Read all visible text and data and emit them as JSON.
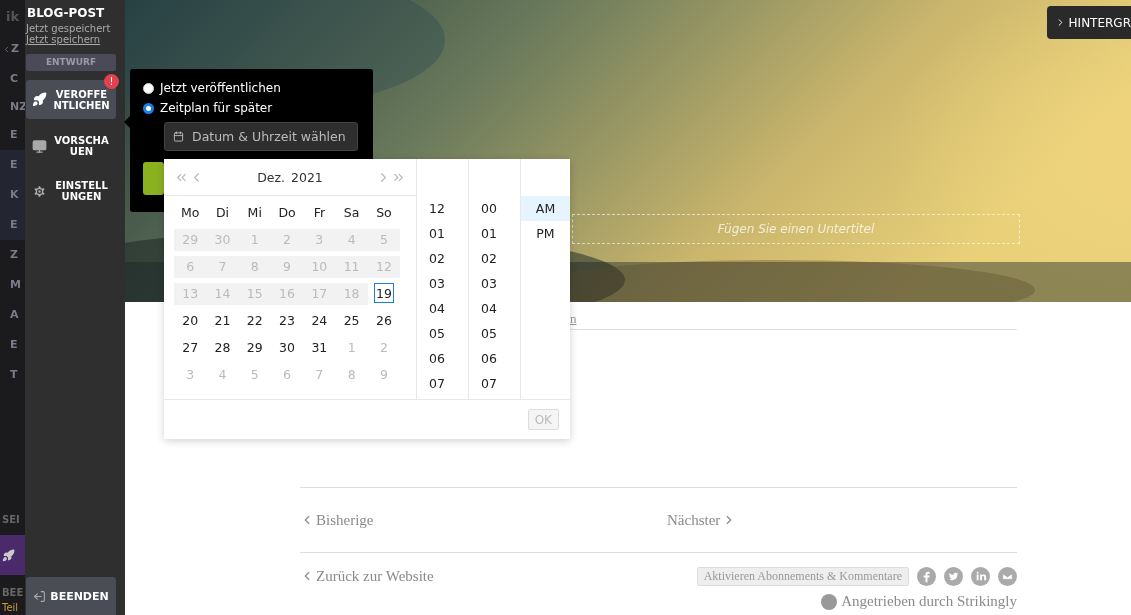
{
  "back_strip": {
    "logo": "ik",
    "items": [
      {
        "label": "Z",
        "kind": "back"
      },
      {
        "label": "C",
        "kind": "item"
      },
      {
        "label": "NZ",
        "kind": "plain"
      },
      {
        "label": "E",
        "kind": "item"
      },
      {
        "label": "E",
        "kind": "highlight"
      },
      {
        "label": "K",
        "kind": "highlight"
      },
      {
        "label": "E",
        "kind": "highlight"
      },
      {
        "label": "Z",
        "kind": "item"
      },
      {
        "label": "M",
        "kind": "item"
      },
      {
        "label": "A",
        "kind": "item"
      },
      {
        "label": "E",
        "kind": "item"
      },
      {
        "label": "T",
        "kind": "item"
      }
    ],
    "section": "SEI",
    "footer_label": "BEE",
    "footer_link": "Teil"
  },
  "sidebar": {
    "title": "BLOG-POST",
    "status": "Jetzt gespeichert",
    "save_link": "Jetzt speichern",
    "badge": "ENTWURF",
    "items": [
      {
        "label": "VEROFFE\nNTLICHEN",
        "kind": "publish",
        "selected": true,
        "alert": "!"
      },
      {
        "label": "VORSCHA\nUEN",
        "kind": "preview",
        "selected": false
      },
      {
        "label": "EINSTELL\nUNGEN",
        "kind": "settings",
        "selected": false
      }
    ],
    "exit_button": "BEENDEN"
  },
  "hero": {
    "kind": "picture",
    "background_button": "HINTERGR",
    "subtitle_placeholder": "Fügen Sie einen Untertitel"
  },
  "publish_popover": {
    "options": [
      {
        "label": "Jetzt veröffentlichen",
        "selected": false
      },
      {
        "label": "Zeitplan für später",
        "selected": true
      }
    ],
    "date_field": {
      "placeholder": "Datum & Uhrzeit wählen"
    }
  },
  "date_picker": {
    "month": "Dez.",
    "year": "2021",
    "weekdays": [
      "Mo",
      "Di",
      "Mi",
      "Do",
      "Fr",
      "Sa",
      "So"
    ],
    "weeks": [
      [
        {
          "day": "29",
          "disabled": true,
          "selected": false
        },
        {
          "day": "30",
          "disabled": true,
          "selected": false
        },
        {
          "day": "1",
          "disabled": true,
          "selected": false
        },
        {
          "day": "2",
          "disabled": true,
          "selected": false
        },
        {
          "day": "3",
          "disabled": true,
          "selected": false
        },
        {
          "day": "4",
          "disabled": true,
          "selected": false
        },
        {
          "day": "5",
          "disabled": true,
          "selected": false
        }
      ],
      [
        {
          "day": "6",
          "disabled": true,
          "selected": false
        },
        {
          "day": "7",
          "disabled": true,
          "selected": false
        },
        {
          "day": "8",
          "disabled": true,
          "selected": false
        },
        {
          "day": "9",
          "disabled": true,
          "selected": false
        },
        {
          "day": "10",
          "disabled": true,
          "selected": false
        },
        {
          "day": "11",
          "disabled": true,
          "selected": false
        },
        {
          "day": "12",
          "disabled": true,
          "selected": false
        }
      ],
      [
        {
          "day": "13",
          "disabled": true,
          "selected": false
        },
        {
          "day": "14",
          "disabled": true,
          "selected": false
        },
        {
          "day": "15",
          "disabled": true,
          "selected": false
        },
        {
          "day": "16",
          "disabled": true,
          "selected": false
        },
        {
          "day": "17",
          "disabled": true,
          "selected": false
        },
        {
          "day": "18",
          "disabled": true,
          "selected": false
        },
        {
          "day": "19",
          "disabled": false,
          "outside": false,
          "selected": true
        }
      ],
      [
        {
          "day": "20",
          "disabled": false,
          "outside": false,
          "selected": false
        },
        {
          "day": "21",
          "disabled": false,
          "outside": false,
          "selected": false
        },
        {
          "day": "22",
          "disabled": false,
          "outside": false,
          "selected": false
        },
        {
          "day": "23",
          "disabled": false,
          "outside": false,
          "selected": false
        },
        {
          "day": "24",
          "disabled": false,
          "outside": false,
          "selected": false
        },
        {
          "day": "25",
          "disabled": false,
          "outside": false,
          "selected": false
        },
        {
          "day": "26",
          "disabled": false,
          "outside": false,
          "selected": false
        }
      ],
      [
        {
          "day": "27",
          "disabled": false,
          "outside": false,
          "selected": false
        },
        {
          "day": "28",
          "disabled": false,
          "outside": false,
          "selected": false
        },
        {
          "day": "29",
          "disabled": false,
          "outside": false,
          "selected": false
        },
        {
          "day": "30",
          "disabled": false,
          "outside": false,
          "selected": false
        },
        {
          "day": "31",
          "disabled": false,
          "outside": false,
          "selected": false
        },
        {
          "day": "1",
          "disabled": false,
          "outside": true,
          "selected": false
        },
        {
          "day": "2",
          "disabled": false,
          "outside": true,
          "selected": false
        }
      ],
      [
        {
          "day": "3",
          "disabled": false,
          "outside": true,
          "selected": false
        },
        {
          "day": "4",
          "disabled": false,
          "outside": true,
          "selected": false
        },
        {
          "day": "5",
          "disabled": false,
          "outside": true,
          "selected": false
        },
        {
          "day": "6",
          "disabled": false,
          "outside": true,
          "selected": false
        },
        {
          "day": "7",
          "disabled": false,
          "outside": true,
          "selected": false
        },
        {
          "day": "8",
          "disabled": false,
          "outside": true,
          "selected": false
        },
        {
          "day": "9",
          "disabled": false,
          "outside": true,
          "selected": false
        }
      ]
    ],
    "hours": [
      {
        "label": "12",
        "selected": false
      },
      {
        "label": "01",
        "selected": false
      },
      {
        "label": "02",
        "selected": false
      },
      {
        "label": "03",
        "selected": false
      },
      {
        "label": "04",
        "selected": false
      },
      {
        "label": "05",
        "selected": false
      },
      {
        "label": "06",
        "selected": false
      },
      {
        "label": "07",
        "selected": false
      }
    ],
    "minutes": [
      {
        "label": "00",
        "selected": false
      },
      {
        "label": "01",
        "selected": false
      },
      {
        "label": "02",
        "selected": false
      },
      {
        "label": "03",
        "selected": false
      },
      {
        "label": "04",
        "selected": false
      },
      {
        "label": "05",
        "selected": false
      },
      {
        "label": "06",
        "selected": false
      },
      {
        "label": "07",
        "selected": false
      }
    ],
    "periods": [
      {
        "label": "AM",
        "selected": true
      },
      {
        "label": "PM",
        "selected": false
      }
    ],
    "ok_button": {
      "label": "OK",
      "disabled": true
    }
  },
  "post": {
    "link_fragment": "n",
    "previous": "Bisherige",
    "next": "Nächster",
    "back_link": "Zurück zur Website",
    "subscribe_button": "Aktivieren Abonnements & Kommentare",
    "social": [
      {
        "kind": "facebook"
      },
      {
        "kind": "twitter"
      },
      {
        "kind": "linkedin"
      },
      {
        "kind": "email"
      }
    ],
    "powered_by": "Angetrieben durch Strikingly"
  }
}
